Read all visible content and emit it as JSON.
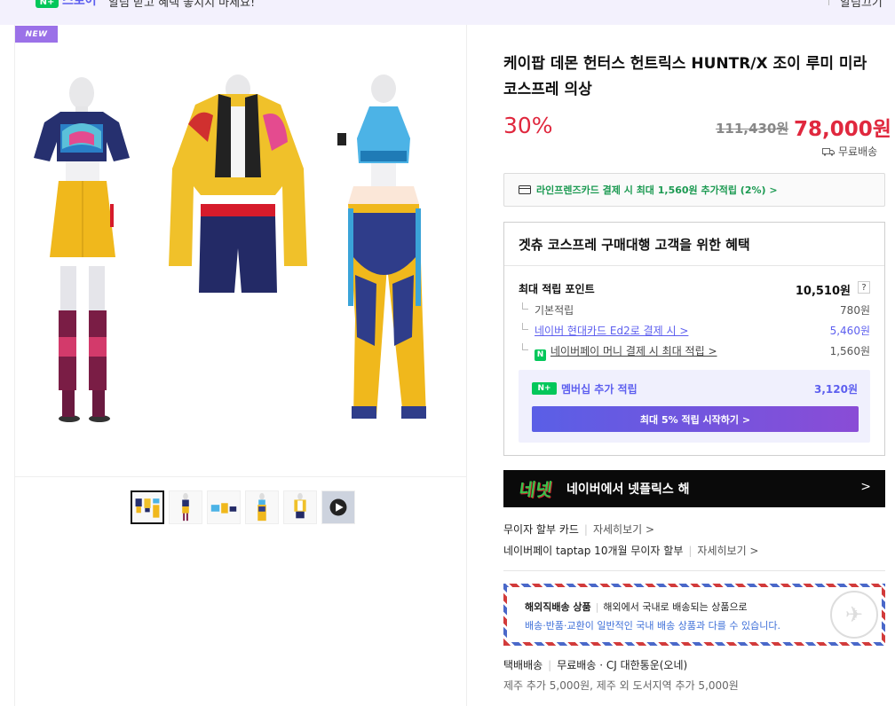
{
  "topbar": {
    "badge": "N+",
    "store": "스토어",
    "promo": "알림 받고 혜택 놓치지 마세요!",
    "close": "알림끄기"
  },
  "gallery": {
    "new_badge": "NEW",
    "thumbnails": [
      "set-1",
      "set-2",
      "set-3",
      "set-4",
      "set-5",
      "video"
    ]
  },
  "product": {
    "title": "케이팝 데몬 헌터스 헌트릭스 HUNTR/X 조이 루미 미라 코스프레 의상",
    "discount": "30%",
    "original_price": "111,430원",
    "price": "78,000원",
    "shipping_badge": "무료배송"
  },
  "card_promo": "라인프렌즈카드 결제 시 최대 1,560원 추가적립 (2%) >",
  "benefits": {
    "title": "겟츄 코스프레 구매대행 고객을 위한 혜택",
    "max_points_label": "최대 적립 포인트",
    "max_points_value": "10,510원",
    "help": "?",
    "items": [
      {
        "label": "기본적립",
        "value": "780원"
      },
      {
        "label": "네이버 현대카드 Ed2로 결제 시 >",
        "value": "5,460원"
      },
      {
        "label": "네이버페이 머니 결제 시 최대 적립 >",
        "value": "1,560원"
      }
    ],
    "npay_icon": "N",
    "membership": {
      "logo": "N+",
      "label": "멤버십 추가 적립",
      "value": "3,120원",
      "button": "최대 5% 적립 시작하기 >"
    }
  },
  "netflix_banner": {
    "logo": "네넷",
    "text": "네이버에서 넷플릭스 해",
    "arrow": ">"
  },
  "installments": [
    {
      "label": "무이자 할부 카드",
      "more": "자세히보기 >"
    },
    {
      "label": "네이버페이 taptap 10개월 무이자 할부",
      "more": "자세히보기 >"
    }
  ],
  "overseas": {
    "title": "해외직배송 상품",
    "desc": "해외에서 국내로 배송되는 상품으로",
    "notice": "배송·반품·교환이 일반적인 국내 배송 상품과 다를 수 있습니다."
  },
  "delivery": {
    "type": "택배배송",
    "fee": "무료배송",
    "courier": "· CJ 대한통운(오네)",
    "extra": "제주 추가 5,000원, 제주 외 도서지역 추가 5,000원"
  },
  "colors": {
    "accent_red": "#e0283e",
    "naver_green": "#03c75a",
    "purple": "#5d5fef"
  }
}
